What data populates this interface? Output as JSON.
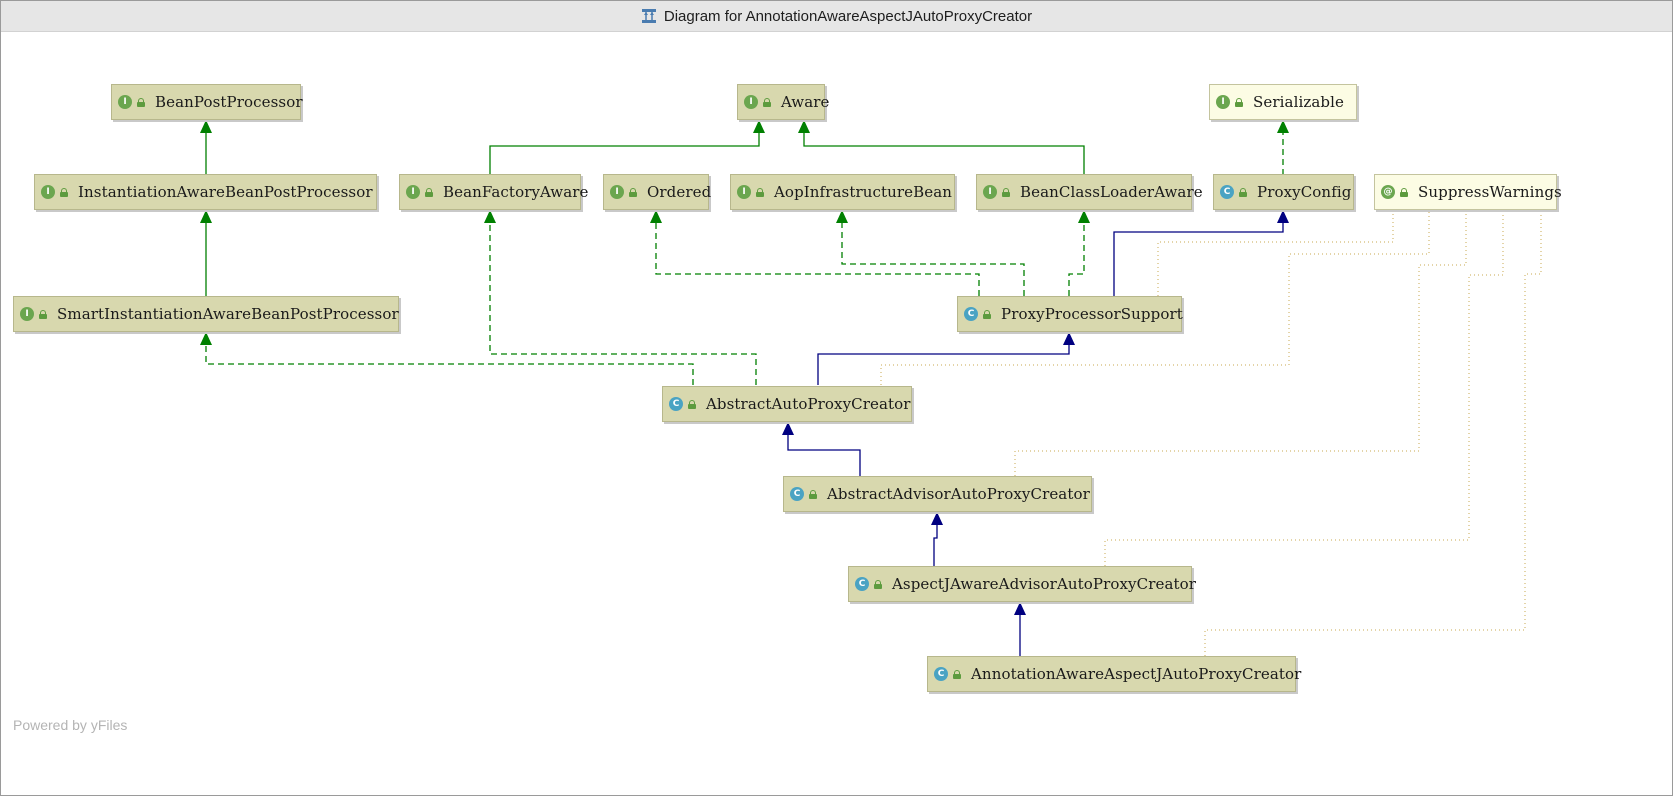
{
  "window": {
    "title": "Diagram for AnnotationAwareAspectJAutoProxyCreator",
    "title_icon": "class-diagram-icon"
  },
  "footer": {
    "text": "Powered by yFiles"
  },
  "colors": {
    "node_fill": "#d8d8ae",
    "node_fill_light": "#fcfce4",
    "implements_edge": "#008000",
    "extends_edge": "#000080",
    "annotation_edge": "#c8a850"
  },
  "nodes": [
    {
      "id": "bean-post-processor",
      "kind": "interface",
      "label": "BeanPostProcessor"
    },
    {
      "id": "aware",
      "kind": "interface",
      "label": "Aware"
    },
    {
      "id": "serializable",
      "kind": "interface",
      "label": "Serializable"
    },
    {
      "id": "instantiation-aware-bean-post-processor",
      "kind": "interface",
      "label": "InstantiationAwareBeanPostProcessor"
    },
    {
      "id": "bean-factory-aware",
      "kind": "interface",
      "label": "BeanFactoryAware"
    },
    {
      "id": "ordered",
      "kind": "interface",
      "label": "Ordered"
    },
    {
      "id": "aop-infrastructure-bean",
      "kind": "interface",
      "label": "AopInfrastructureBean"
    },
    {
      "id": "bean-class-loader-aware",
      "kind": "interface",
      "label": "BeanClassLoaderAware"
    },
    {
      "id": "proxy-config",
      "kind": "class",
      "label": "ProxyConfig"
    },
    {
      "id": "suppress-warnings",
      "kind": "annotation",
      "label": "SuppressWarnings"
    },
    {
      "id": "smart-instantiation-aware-bean-post-processor",
      "kind": "interface",
      "label": "SmartInstantiationAwareBeanPostProcessor"
    },
    {
      "id": "proxy-processor-support",
      "kind": "class",
      "label": "ProxyProcessorSupport"
    },
    {
      "id": "abstract-auto-proxy-creator",
      "kind": "class",
      "label": "AbstractAutoProxyCreator"
    },
    {
      "id": "abstract-advisor-auto-proxy-creator",
      "kind": "class",
      "label": "AbstractAdvisorAutoProxyCreator"
    },
    {
      "id": "aspectj-aware-advisor-auto-proxy-creator",
      "kind": "class",
      "label": "AspectJAwareAdvisorAutoProxyCreator"
    },
    {
      "id": "annotation-aware-aspectj-auto-proxy-creator",
      "kind": "class",
      "label": "AnnotationAwareAspectJAutoProxyCreator"
    }
  ],
  "edges": [
    {
      "from": "instantiation-aware-bean-post-processor",
      "to": "bean-post-processor",
      "type": "extends-interface"
    },
    {
      "from": "smart-instantiation-aware-bean-post-processor",
      "to": "instantiation-aware-bean-post-processor",
      "type": "extends-interface"
    },
    {
      "from": "bean-factory-aware",
      "to": "aware",
      "type": "extends-interface"
    },
    {
      "from": "bean-class-loader-aware",
      "to": "aware",
      "type": "extends-interface"
    },
    {
      "from": "proxy-config",
      "to": "serializable",
      "type": "implements"
    },
    {
      "from": "proxy-processor-support",
      "to": "ordered",
      "type": "implements"
    },
    {
      "from": "proxy-processor-support",
      "to": "aop-infrastructure-bean",
      "type": "implements"
    },
    {
      "from": "proxy-processor-support",
      "to": "bean-class-loader-aware",
      "type": "implements"
    },
    {
      "from": "proxy-processor-support",
      "to": "proxy-config",
      "type": "extends"
    },
    {
      "from": "abstract-auto-proxy-creator",
      "to": "smart-instantiation-aware-bean-post-processor",
      "type": "implements"
    },
    {
      "from": "abstract-auto-proxy-creator",
      "to": "bean-factory-aware",
      "type": "implements"
    },
    {
      "from": "abstract-auto-proxy-creator",
      "to": "proxy-processor-support",
      "type": "extends"
    },
    {
      "from": "abstract-advisor-auto-proxy-creator",
      "to": "abstract-auto-proxy-creator",
      "type": "extends"
    },
    {
      "from": "aspectj-aware-advisor-auto-proxy-creator",
      "to": "abstract-advisor-auto-proxy-creator",
      "type": "extends"
    },
    {
      "from": "annotation-aware-aspectj-auto-proxy-creator",
      "to": "aspectj-aware-advisor-auto-proxy-creator",
      "type": "extends"
    },
    {
      "from": "proxy-processor-support",
      "to": "suppress-warnings",
      "type": "annotated"
    },
    {
      "from": "abstract-auto-proxy-creator",
      "to": "suppress-warnings",
      "type": "annotated"
    },
    {
      "from": "abstract-advisor-auto-proxy-creator",
      "to": "suppress-warnings",
      "type": "annotated"
    },
    {
      "from": "aspectj-aware-advisor-auto-proxy-creator",
      "to": "suppress-warnings",
      "type": "annotated"
    },
    {
      "from": "annotation-aware-aspectj-auto-proxy-creator",
      "to": "suppress-warnings",
      "type": "annotated"
    }
  ]
}
